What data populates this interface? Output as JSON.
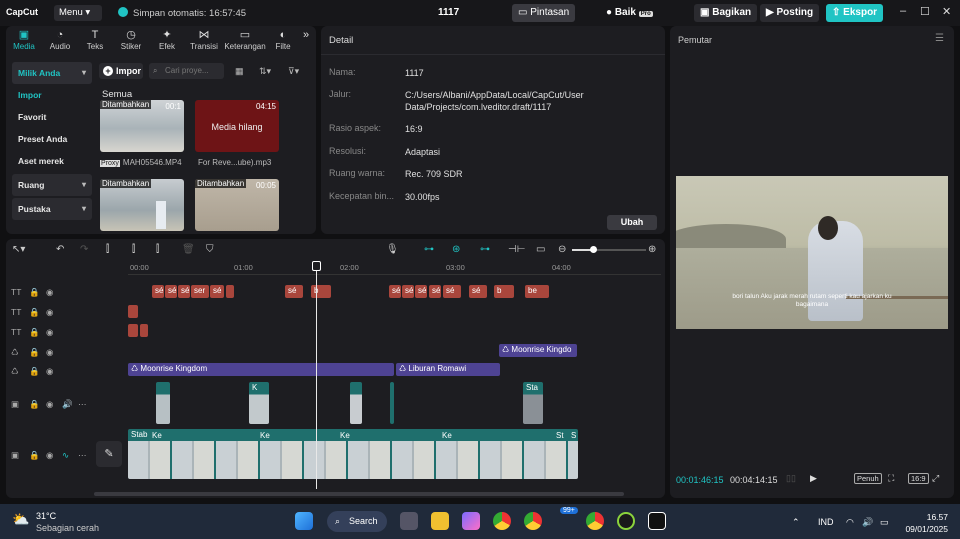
{
  "app": {
    "logo": "CapCut",
    "menu_label": "Menu",
    "autosave": "Simpan otomatis: 16:57:45",
    "project_name": "1117",
    "shortcuts_label": "Pintasan",
    "quality_label": "Baik",
    "pro_badge": "Pro",
    "share_label": "Bagikan",
    "post_label": "Posting",
    "export_label": "Ekspor"
  },
  "media_tabs": [
    {
      "label": "Media",
      "icon": "media-icon"
    },
    {
      "label": "Audio",
      "icon": "audio-icon"
    },
    {
      "label": "Teks",
      "icon": "text-icon"
    },
    {
      "label": "Stiker",
      "icon": "sticker-icon"
    },
    {
      "label": "Efek",
      "icon": "effect-icon"
    },
    {
      "label": "Transisi",
      "icon": "transition-icon"
    },
    {
      "label": "Keterangan",
      "icon": "caption-icon"
    },
    {
      "label": "Filte",
      "icon": "filter-icon"
    }
  ],
  "sidebar": {
    "items": [
      "Milik Anda",
      "Impor",
      "Favorit",
      "Preset Anda",
      "Aset merek",
      "Ruang",
      "Pustaka"
    ]
  },
  "media": {
    "import_label": "Impor",
    "search_placeholder": "Cari proye...",
    "section_label": "Semua",
    "items": [
      {
        "badge": "Ditambahkan",
        "duration": "00:1",
        "file": "MAH05546.MP4",
        "proxy": "Proxy"
      },
      {
        "badge": "",
        "duration": "04:15",
        "file": "For Reve...ube).mp3",
        "missing": "Media hilang"
      },
      {
        "badge": "Ditambahkan",
        "duration": "",
        "file": ""
      },
      {
        "badge": "Ditambahkan",
        "duration": "00:05",
        "file": ""
      }
    ]
  },
  "detail": {
    "title": "Detail",
    "rows": [
      {
        "k": "Nama:",
        "v": "1117"
      },
      {
        "k": "Jalur:",
        "v": "C:/Users/Albani/AppData/Local/CapCut/User Data/Projects/com.lveditor.draft/1117"
      },
      {
        "k": "Rasio aspek:",
        "v": "16:9"
      },
      {
        "k": "Resolusi:",
        "v": "Adaptasi"
      },
      {
        "k": "Ruang warna:",
        "v": "Rec. 709 SDR"
      },
      {
        "k": "Kecepatan bin...",
        "v": "30.00fps"
      }
    ],
    "edit_label": "Ubah"
  },
  "player": {
    "title": "Pemutar",
    "subtitle": "bori talun Aku jarak merah rutam seperti kau ajarkan ku bagaimana",
    "current_time": "00:01:46:15",
    "total_time": "00:04:14:15",
    "full_label": "Penuh",
    "ratio_label": "16:9"
  },
  "timeline": {
    "ruler": [
      "00:00",
      "01:00",
      "02:00",
      "03:00",
      "04:00"
    ],
    "clips_purple": [
      {
        "label": "Moonrise Kingdo"
      },
      {
        "label": "Moonrise Kingdom"
      },
      {
        "label": "Liburan Romawi"
      }
    ],
    "text_clips": [
      "sé",
      "sé",
      "sé",
      "ser",
      "sé",
      "sé",
      "b",
      "sé",
      "sé",
      "sé",
      "sé",
      "sé",
      "sé",
      "b",
      "be"
    ],
    "video_labels": [
      "Stab",
      "Ke",
      "K",
      "Ke",
      "Ke",
      "Ke",
      "Ke",
      "Sta",
      "St",
      "S"
    ]
  },
  "taskbar": {
    "temp": "31°C",
    "weather": "Sebagian cerah",
    "search_label": "Search",
    "notif_badge": "99+",
    "lang": "IND",
    "time": "16.57",
    "date": "09/01/2025"
  }
}
